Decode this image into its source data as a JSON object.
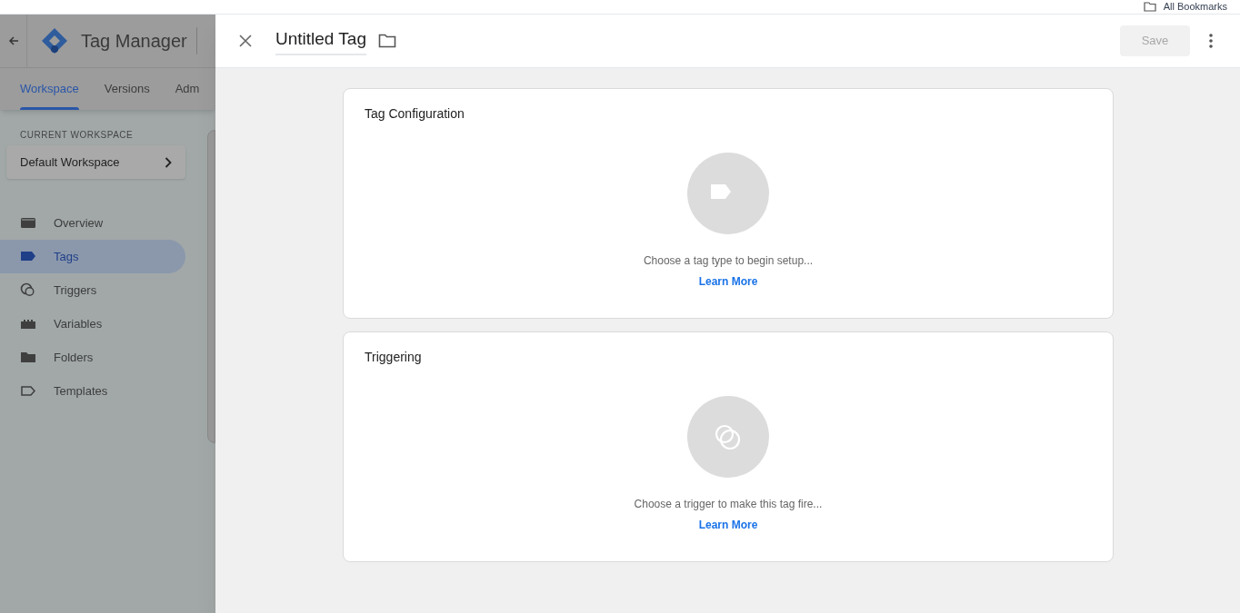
{
  "browser_bar": {
    "bookmarks_label": "All Bookmarks"
  },
  "app": {
    "title": "Tag Manager",
    "tabs": [
      {
        "label": "Workspace",
        "selected": true
      },
      {
        "label": "Versions",
        "selected": false
      },
      {
        "label": "Adm",
        "selected": false
      }
    ],
    "workspace_caption": "CURRENT WORKSPACE",
    "workspace_name": "Default Workspace",
    "nav": [
      {
        "label": "Overview",
        "kind": "overview",
        "selected": false
      },
      {
        "label": "Tags",
        "kind": "tag",
        "selected": true
      },
      {
        "label": "Triggers",
        "kind": "trigger",
        "selected": false
      },
      {
        "label": "Variables",
        "kind": "variable",
        "selected": false
      },
      {
        "label": "Folders",
        "kind": "folder",
        "selected": false
      },
      {
        "label": "Templates",
        "kind": "template",
        "selected": false
      }
    ]
  },
  "editor": {
    "title": "Untitled Tag",
    "save_label": "Save",
    "save_disabled": true,
    "cards": [
      {
        "title": "Tag Configuration",
        "kind": "tag",
        "prompt": "Choose a tag type to begin setup...",
        "link": "Learn More"
      },
      {
        "title": "Triggering",
        "kind": "trigger",
        "prompt": "Choose a trigger to make this tag fire...",
        "link": "Learn More"
      }
    ]
  }
}
